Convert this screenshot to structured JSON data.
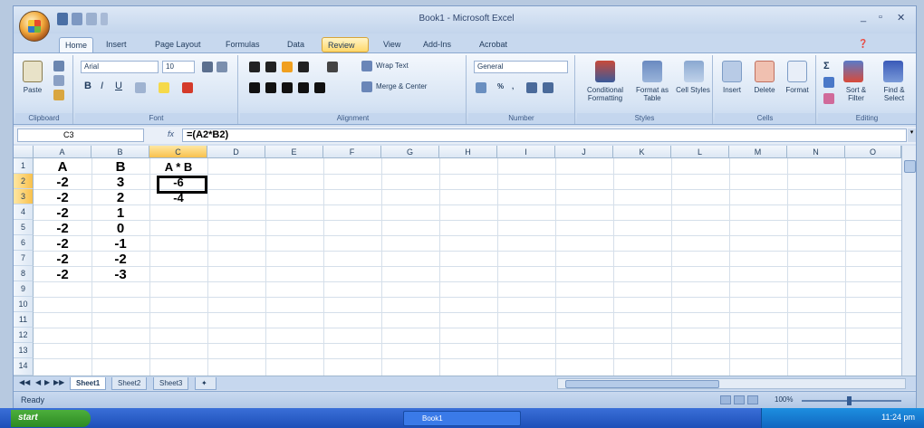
{
  "window": {
    "title": "Book1 - Microsoft Excel"
  },
  "tabs": [
    "Home",
    "Insert",
    "Page Layout",
    "Formulas",
    "Data",
    "Review",
    "View",
    "Add-Ins",
    "Acrobat"
  ],
  "ribbon": {
    "clipboard": {
      "paste": "Paste",
      "label": "Clipboard"
    },
    "font": {
      "name": "Arial",
      "size": "10",
      "label": "Font"
    },
    "alignment": {
      "wrap": "Wrap Text",
      "merge": "Merge & Center",
      "label": "Alignment"
    },
    "number": {
      "format": "General",
      "label": "Number"
    },
    "styles": {
      "conditional": "Conditional Formatting",
      "format_table": "Format as Table",
      "cell_styles": "Cell Styles",
      "label": "Styles"
    },
    "cells": {
      "insert": "Insert",
      "delete": "Delete",
      "format": "Format",
      "label": "Cells"
    },
    "editing": {
      "sort": "Sort & Filter",
      "find": "Find & Select",
      "label": "Editing"
    }
  },
  "formula_bar": {
    "name_box": "C3",
    "fx": "fx",
    "formula": "=(A2*B2)"
  },
  "columns": [
    "A",
    "B",
    "C",
    "D",
    "E",
    "F",
    "G",
    "H",
    "I",
    "J",
    "K",
    "L",
    "M",
    "N",
    "O"
  ],
  "rows": [
    "1",
    "2",
    "3",
    "4",
    "5",
    "6",
    "7",
    "8",
    "9",
    "10",
    "11",
    "12",
    "13",
    "14"
  ],
  "cells": {
    "A": [
      "A",
      "-2",
      "-2",
      "-2",
      "-2",
      "-2",
      "-2",
      "-2"
    ],
    "B": [
      "B",
      "3",
      "2",
      "1",
      "0",
      "-1",
      "-2",
      "-3"
    ],
    "C": [
      "A * B",
      "-6",
      "-4"
    ]
  },
  "sheets": [
    "Sheet1",
    "Sheet2",
    "Sheet3"
  ],
  "status": {
    "text": "Ready",
    "zoom": "100%"
  },
  "taskbar": {
    "start": "start",
    "item": "Book1",
    "clock": "11:24 pm"
  }
}
